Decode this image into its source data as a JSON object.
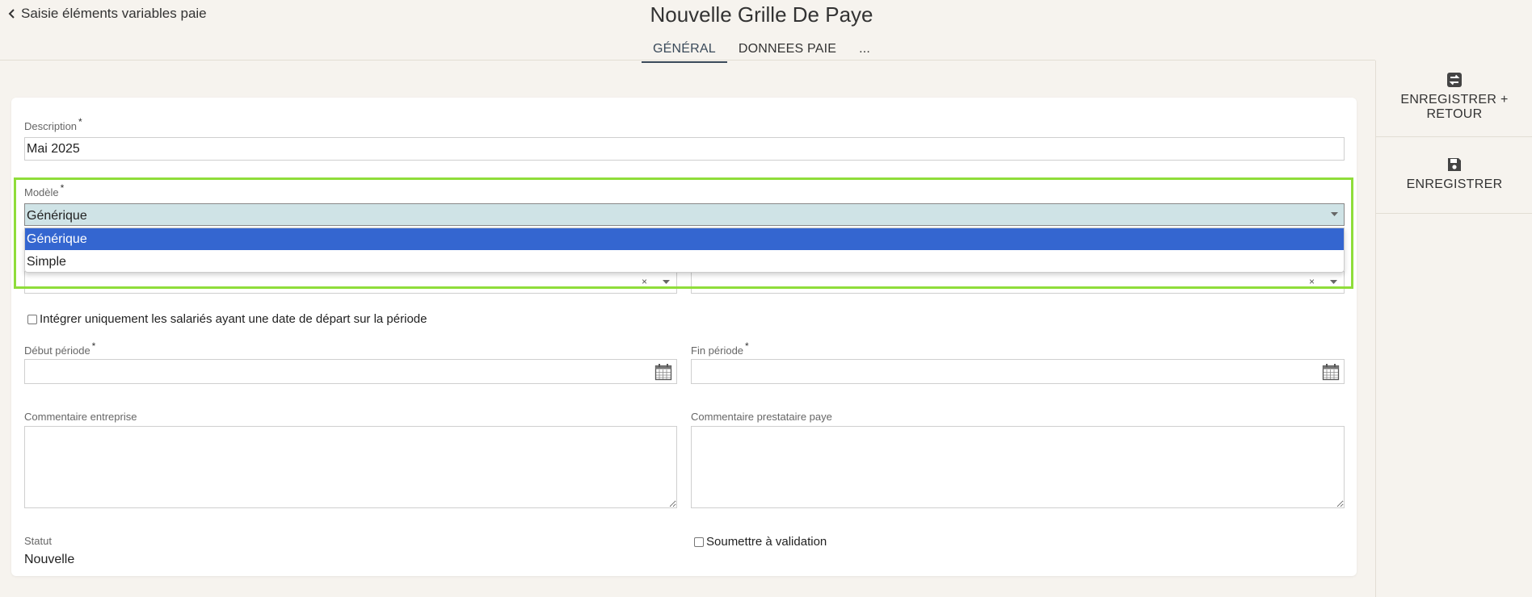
{
  "header": {
    "back_label": "Saisie éléments variables paie",
    "title": "Nouvelle Grille De Paye",
    "tabs": [
      {
        "label": "GÉNÉRAL",
        "active": true
      },
      {
        "label": "DONNEES PAIE",
        "active": false
      },
      {
        "label": "...",
        "active": false
      }
    ]
  },
  "actions": {
    "save_return_line1": "ENREGISTRER +",
    "save_return_line2": "RETOUR",
    "save": "ENREGISTRER"
  },
  "form": {
    "description": {
      "label": "Description",
      "required_mark": "*",
      "value": "Mai 2025"
    },
    "modele": {
      "label": "Modèle",
      "required_mark": "*",
      "value": "Générique",
      "options": [
        "Générique",
        "Simple"
      ],
      "highlight_color": "#8fdd3a",
      "selected_option_color": "#3466d0"
    },
    "clear_symbol": "×",
    "integrer_checkbox": "Intégrer uniquement les salariés ayant une date de départ sur la période",
    "debut_periode": {
      "label": "Début période",
      "required_mark": "*",
      "value": ""
    },
    "fin_periode": {
      "label": "Fin période",
      "required_mark": "*",
      "value": ""
    },
    "commentaire_entreprise": {
      "label": "Commentaire entreprise",
      "value": ""
    },
    "commentaire_prestataire": {
      "label": "Commentaire prestataire paye",
      "value": ""
    },
    "statut": {
      "label": "Statut",
      "value": "Nouvelle"
    },
    "soumettre_checkbox": "Soumettre à validation"
  },
  "icons": [
    "chevron-left-icon",
    "save-return-icon",
    "floppy-disk-icon",
    "calendar-icon",
    "caret-down-icon",
    "clear-icon"
  ]
}
